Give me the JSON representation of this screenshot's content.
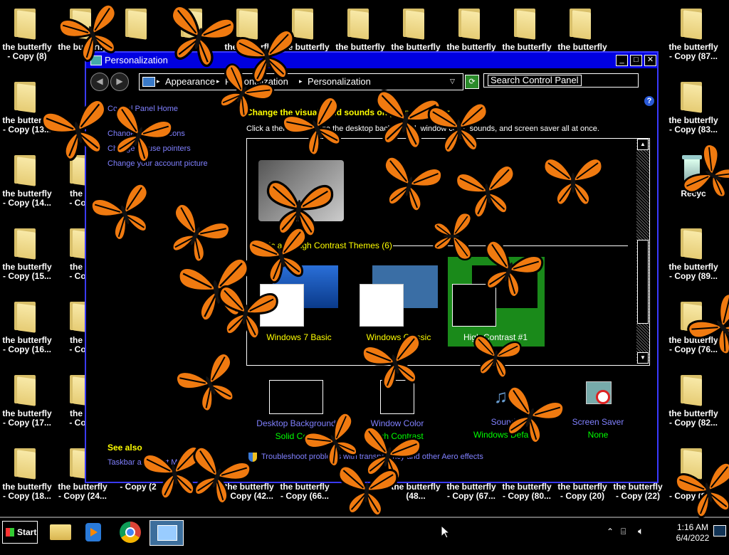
{
  "desktop": {
    "icons": [
      {
        "line1": "the butterfly",
        "line2": "- Copy (8)"
      },
      {
        "line1": "the butterfly",
        "line2": ""
      },
      {
        "line1": "",
        "line2": ""
      },
      {
        "line1": "",
        "line2": ""
      },
      {
        "line1": "the butterfly",
        "line2": ""
      },
      {
        "line1": "the butterfly",
        "line2": ""
      },
      {
        "line1": "the butterfly",
        "line2": ""
      },
      {
        "line1": "the butterfly",
        "line2": ""
      },
      {
        "line1": "the butterfly",
        "line2": ""
      },
      {
        "line1": "the butterfly",
        "line2": ""
      },
      {
        "line1": "the butterfly",
        "line2": ""
      },
      {
        "line1": "the butterfly",
        "line2": "- Copy (87..."
      },
      {
        "line1": "the butterfly",
        "line2": "- Copy (13..."
      },
      {
        "line1": "the butterfly",
        "line2": "- Copy (83..."
      },
      {
        "line1": "the butterfly",
        "line2": "- Copy (14..."
      },
      {
        "line1": "the bu",
        "line2": "- Copy"
      },
      {
        "line1": "Recyc",
        "line2": ""
      },
      {
        "line1": "the butterfly",
        "line2": "- Copy (15..."
      },
      {
        "line1": "the bu",
        "line2": "- Copy"
      },
      {
        "line1": "the butterfly",
        "line2": "- Copy (89..."
      },
      {
        "line1": "the butterfly",
        "line2": "- Copy (16..."
      },
      {
        "line1": "the bu",
        "line2": "- Copy"
      },
      {
        "line1": "the butterfly",
        "line2": "- Copy (76..."
      },
      {
        "line1": "the butterfly",
        "line2": "- Copy (17..."
      },
      {
        "line1": "the bu",
        "line2": "- Copy"
      },
      {
        "line1": "the butterfly",
        "line2": "- Copy (82..."
      },
      {
        "line1": "the butterfly",
        "line2": "- Copy (18..."
      },
      {
        "line1": "the butterfly",
        "line2": "- Copy (24..."
      },
      {
        "line1": "",
        "line2": "- Copy (2"
      },
      {
        "line1": "the butterfly",
        "line2": "- Copy (42..."
      },
      {
        "line1": "the butterfly",
        "line2": "- Copy (66..."
      },
      {
        "line1": "the butterfly",
        "line2": "(48..."
      },
      {
        "line1": "the butterfly",
        "line2": "- Copy (67..."
      },
      {
        "line1": "the butterfly",
        "line2": "- Copy (80..."
      },
      {
        "line1": "the butterfly",
        "line2": "- Copy (20)"
      },
      {
        "line1": "the butterfly",
        "line2": "- Copy (22)"
      },
      {
        "line1": "the",
        "line2": "- Copy (88..."
      }
    ]
  },
  "window": {
    "title": "Personalization",
    "minimize": "_",
    "maximize": "□",
    "close": "✕",
    "breadcrumb": [
      "Appearance",
      "Personalization",
      "Personalization"
    ],
    "search_placeholder": "Search Control Panel",
    "sidebar_links": [
      "Control Panel Home",
      "Change desktop icons",
      "Change mouse pointers",
      "Change your account picture"
    ],
    "heading": "Change the visuals and sounds on your computer",
    "subheading": "Click a theme to change the desktop background, window color, sounds, and screen saver all at once.",
    "section_title": "Basic and High Contrast Themes (6)",
    "themes": [
      {
        "name": "Windows 7 Basic"
      },
      {
        "name": "Windows Classic"
      },
      {
        "name": "High Contrast #1"
      }
    ],
    "customize": [
      {
        "label": "Desktop Background",
        "value": "Solid Color"
      },
      {
        "label": "Window Color",
        "value": "High Contrast"
      },
      {
        "label": "Sounds",
        "value": "Windows Default"
      },
      {
        "label": "Screen Saver",
        "value": "None"
      }
    ],
    "see_also_title": "See also",
    "see_also_links": [
      "Taskbar and Start Menu"
    ],
    "troubleshoot_link": "Troubleshoot problems with transparency and other Aero effects"
  },
  "taskbar": {
    "start_label": "Start",
    "time": "1:16 AM",
    "date": "6/4/2022",
    "tray_chevron": "⌃"
  },
  "colors": {
    "title_bar": "#0000e0",
    "link": "#8080ff",
    "heading": "#ffff00",
    "value": "#00ff00",
    "selected_theme": "#1a8a1a",
    "butterfly": "#f07a10"
  }
}
